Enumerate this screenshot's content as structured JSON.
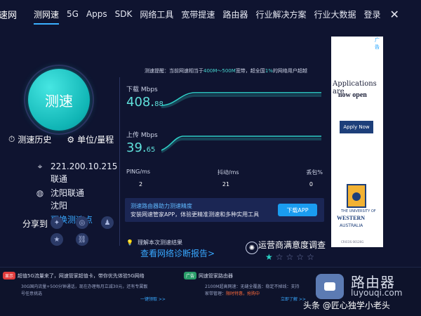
{
  "nav": {
    "brand": "速网",
    "items": [
      "测网速",
      "5G",
      "Apps",
      "SDK",
      "网络工具",
      "宽带提速",
      "路由器",
      "行业解决方案",
      "行业大数据",
      "登录"
    ],
    "close": "✕"
  },
  "left": {
    "gauge_label": "测速",
    "history": "测速历史",
    "unit": "单位/量程",
    "ip": "221.200.10.215",
    "isp": "联通",
    "location1": "沈阳联通",
    "location2": "沈阳",
    "switch_point": "更换测速点",
    "share": "分享到"
  },
  "middle": {
    "notice_pre": "测速提醒：当前网速相当于",
    "notice_hl": "400M～500M",
    "notice_mid": "宽带，超全国",
    "notice_pct": "1%",
    "notice_post": "的网络用户超越",
    "download_label": "下载 Mbps",
    "download_int": "408.",
    "download_dec": "88",
    "upload_label": "上传 Mbps",
    "upload_int": "39.",
    "upload_dec": "65",
    "ping_label": "PING/ms",
    "jitter_label": "抖动/ms",
    "loss_label": "丢包%",
    "ping": "2",
    "jitter": "21",
    "loss": "0",
    "promo_title": "测速路由器助力测速精度",
    "promo_text": "安装网速管家APP，体验更精准测速和多种实用工具",
    "promo_btn": "下载APP",
    "diag_hint": "理解本次测速结果",
    "diag_link": "查看网络诊断报告>",
    "survey_title": "运营商满意度调查",
    "stars": [
      "★",
      "☆",
      "☆",
      "☆",
      "☆"
    ]
  },
  "ad": {
    "head": "广告",
    "line1": "Applications are",
    "line2": "now open",
    "btn": "Apply Now",
    "small": "THE UNIVERSITY OF",
    "uwa": "WESTERN",
    "aus": "AUSTRALIA",
    "cricos": "CRICOS 00126G"
  },
  "bottom": {
    "tag1": "显示",
    "b1a": "超值5G流量来了，网速管家超值卡，带你优先体验5G网络",
    "b2": "30G国内流量+500分钟通话，现在办理每月立减30元，还有专属靓",
    "b3": "号任意挑选",
    "b4": "一键领取 >>",
    "tag2": "广告",
    "c1": "网速管家路由器",
    "c2": "2100M超高网速：无缝全覆盖：稳定不掉线：支持",
    "c3a": "家带管理：",
    "c3b": "限时特惠，抢购中",
    "c4": "立即了解 >>"
  },
  "watermark": {
    "big": "路由器",
    "small": "luyouqi.com",
    "author": "头条 @匠心独学小老头"
  }
}
